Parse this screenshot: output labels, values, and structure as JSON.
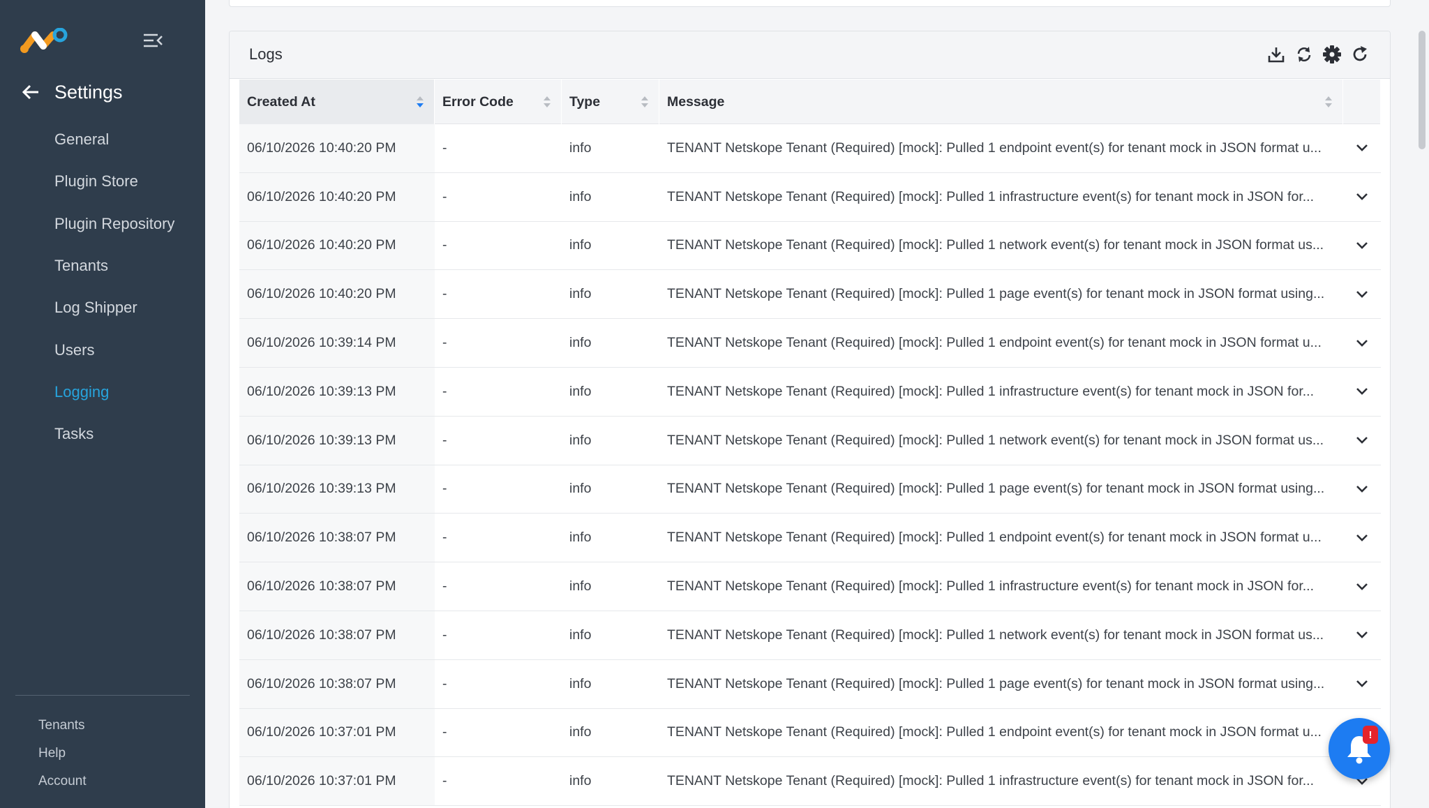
{
  "app": {
    "colors": {
      "sidebar_bg": "#2f3d4c",
      "active": "#27a4dd",
      "bell": "#1d7cf2",
      "badge": "#e5232b"
    }
  },
  "sidebar": {
    "title": "Settings",
    "items": [
      {
        "label": "General"
      },
      {
        "label": "Plugin Store"
      },
      {
        "label": "Plugin Repository"
      },
      {
        "label": "Tenants"
      },
      {
        "label": "Log Shipper"
      },
      {
        "label": "Users"
      },
      {
        "label": "Logging",
        "active": true
      },
      {
        "label": "Tasks"
      }
    ],
    "footer": [
      {
        "label": "Tenants"
      },
      {
        "label": "Help"
      },
      {
        "label": "Account"
      }
    ]
  },
  "logs": {
    "title": "Logs",
    "toolbar": [
      "download-icon",
      "sync-icon",
      "gear-icon",
      "refresh-icon"
    ],
    "columns": {
      "created_at": "Created At",
      "error_code": "Error Code",
      "type": "Type",
      "message": "Message"
    },
    "rows": [
      {
        "created": "06/10/2026 10:40:20 PM",
        "error": "-",
        "type": "info",
        "message": "TENANT Netskope Tenant (Required) [mock]: Pulled 1 endpoint event(s) for tenant mock in JSON format u..."
      },
      {
        "created": "06/10/2026 10:40:20 PM",
        "error": "-",
        "type": "info",
        "message": "TENANT Netskope Tenant (Required) [mock]: Pulled 1 infrastructure event(s) for tenant mock in JSON for..."
      },
      {
        "created": "06/10/2026 10:40:20 PM",
        "error": "-",
        "type": "info",
        "message": "TENANT Netskope Tenant (Required) [mock]: Pulled 1 network event(s) for tenant mock in JSON format us..."
      },
      {
        "created": "06/10/2026 10:40:20 PM",
        "error": "-",
        "type": "info",
        "message": "TENANT Netskope Tenant (Required) [mock]: Pulled 1 page event(s) for tenant mock in JSON format using..."
      },
      {
        "created": "06/10/2026 10:39:14 PM",
        "error": "-",
        "type": "info",
        "message": "TENANT Netskope Tenant (Required) [mock]: Pulled 1 endpoint event(s) for tenant mock in JSON format u..."
      },
      {
        "created": "06/10/2026 10:39:13 PM",
        "error": "-",
        "type": "info",
        "message": "TENANT Netskope Tenant (Required) [mock]: Pulled 1 infrastructure event(s) for tenant mock in JSON for..."
      },
      {
        "created": "06/10/2026 10:39:13 PM",
        "error": "-",
        "type": "info",
        "message": "TENANT Netskope Tenant (Required) [mock]: Pulled 1 network event(s) for tenant mock in JSON format us..."
      },
      {
        "created": "06/10/2026 10:39:13 PM",
        "error": "-",
        "type": "info",
        "message": "TENANT Netskope Tenant (Required) [mock]: Pulled 1 page event(s) for tenant mock in JSON format using..."
      },
      {
        "created": "06/10/2026 10:38:07 PM",
        "error": "-",
        "type": "info",
        "message": "TENANT Netskope Tenant (Required) [mock]: Pulled 1 endpoint event(s) for tenant mock in JSON format u..."
      },
      {
        "created": "06/10/2026 10:38:07 PM",
        "error": "-",
        "type": "info",
        "message": "TENANT Netskope Tenant (Required) [mock]: Pulled 1 infrastructure event(s) for tenant mock in JSON for..."
      },
      {
        "created": "06/10/2026 10:38:07 PM",
        "error": "-",
        "type": "info",
        "message": "TENANT Netskope Tenant (Required) [mock]: Pulled 1 network event(s) for tenant mock in JSON format us..."
      },
      {
        "created": "06/10/2026 10:38:07 PM",
        "error": "-",
        "type": "info",
        "message": "TENANT Netskope Tenant (Required) [mock]: Pulled 1 page event(s) for tenant mock in JSON format using..."
      },
      {
        "created": "06/10/2026 10:37:01 PM",
        "error": "-",
        "type": "info",
        "message": "TENANT Netskope Tenant (Required) [mock]: Pulled 1 endpoint event(s) for tenant mock in JSON format u..."
      },
      {
        "created": "06/10/2026 10:37:01 PM",
        "error": "-",
        "type": "info",
        "message": "TENANT Netskope Tenant (Required) [mock]: Pulled 1 infrastructure event(s) for tenant mock in JSON for..."
      }
    ]
  },
  "notifications": {
    "badge": "!"
  }
}
